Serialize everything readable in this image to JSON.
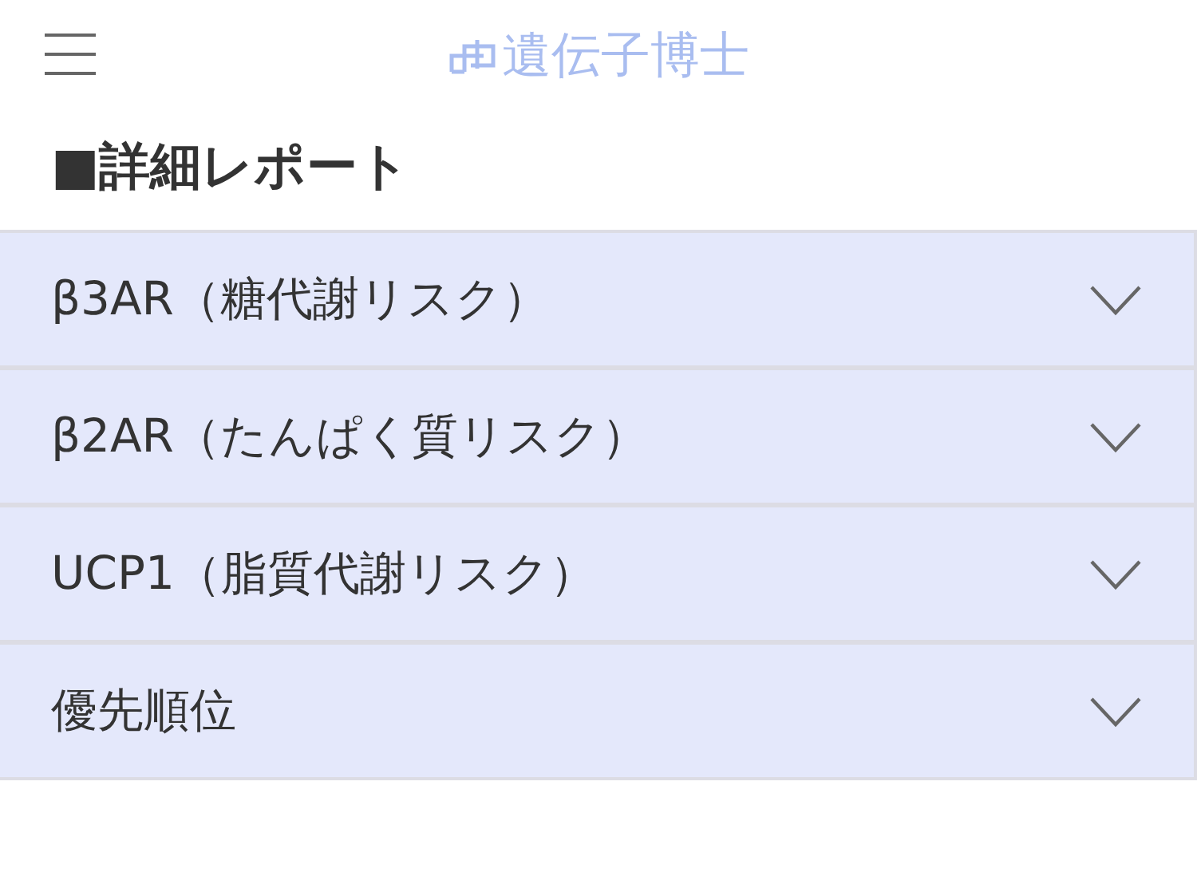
{
  "header": {
    "logo": "遺伝子博士"
  },
  "heading": "■詳細レポート",
  "sections": [
    {
      "title": "β3AR（糖代謝リスク）",
      "expanded": false
    },
    {
      "title": "β2AR（たんぱく質リスク）",
      "expanded": false
    },
    {
      "title": "UCP1（脂質代謝リスク）",
      "expanded": false
    },
    {
      "title": "優先順位",
      "expanded": false
    }
  ]
}
